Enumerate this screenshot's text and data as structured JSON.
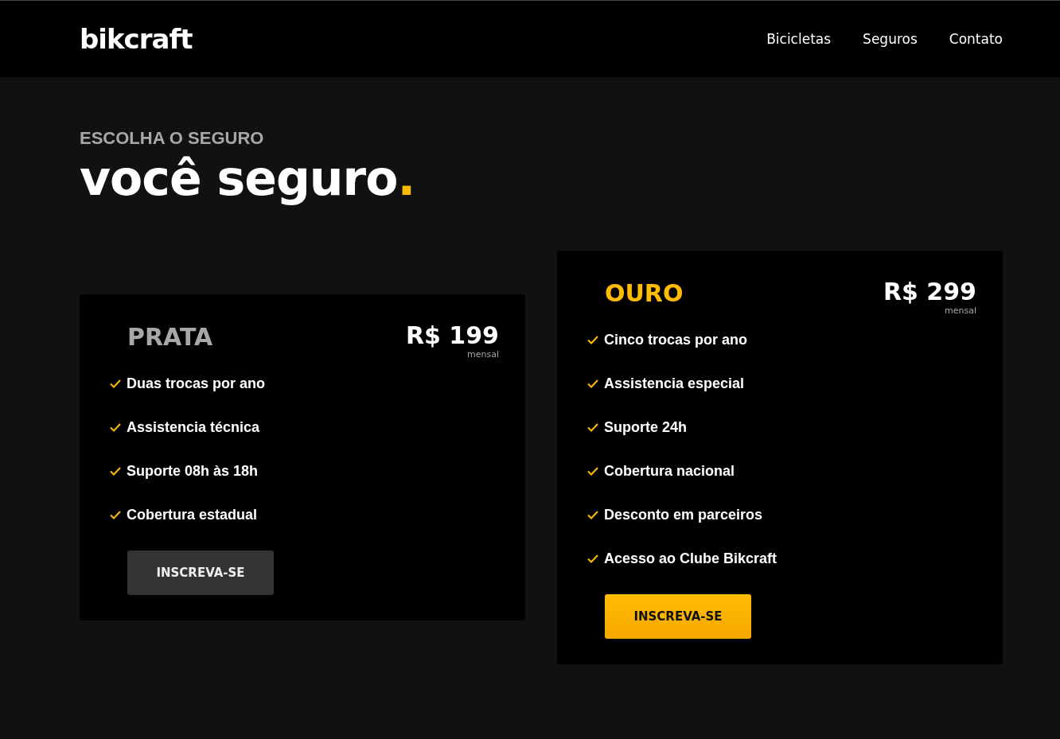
{
  "header": {
    "logo": "bikcraft",
    "nav": [
      {
        "label": "Bicicletas"
      },
      {
        "label": "Seguros"
      },
      {
        "label": "Contato"
      }
    ]
  },
  "intro": {
    "subtitle": "ESCOLHA O SEGURO",
    "title": "você seguro",
    "title_dot": "."
  },
  "plans": [
    {
      "name": "PRATA",
      "price": "R$ 199",
      "period": "mensal",
      "featured": false,
      "features": [
        "Duas trocas por ano",
        "Assistencia técnica",
        "Suporte 08h às 18h",
        "Cobertura estadual"
      ],
      "button": "INSCREVA-SE"
    },
    {
      "name": "OURO",
      "price": "R$ 299",
      "period": "mensal",
      "featured": true,
      "features": [
        "Cinco trocas por ano",
        "Assistencia especial",
        "Suporte 24h",
        "Cobertura nacional",
        "Desconto em parceiros",
        "Acesso ao Clube Bikcraft"
      ],
      "button": "INSCREVA-SE"
    }
  ]
}
